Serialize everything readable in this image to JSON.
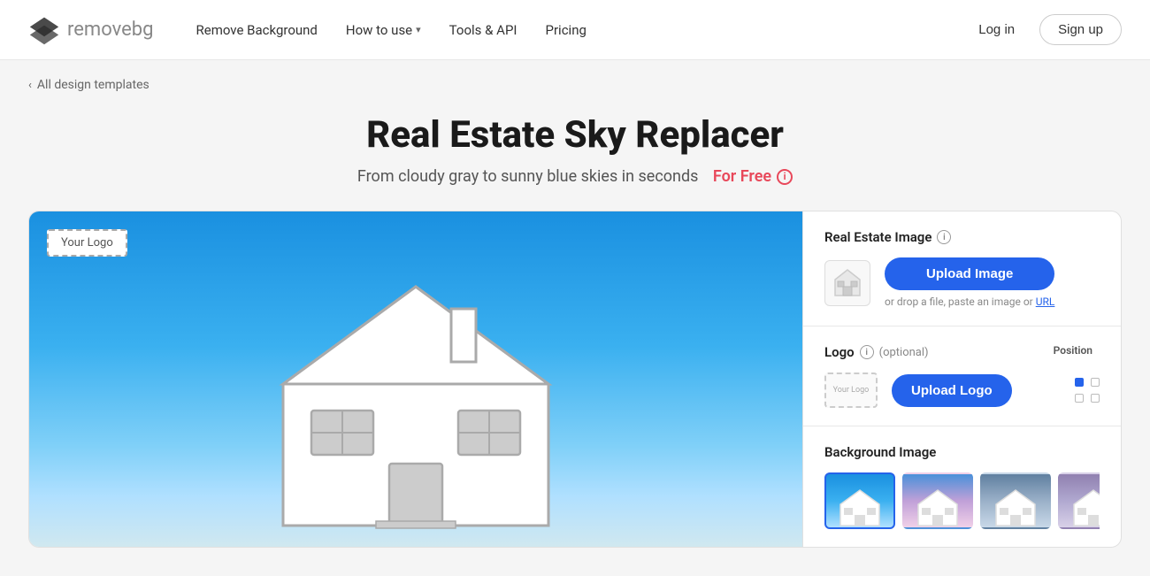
{
  "header": {
    "logo_text": "remove",
    "logo_text_suffix": "bg",
    "nav": [
      {
        "id": "remove-bg",
        "label": "Remove Background",
        "has_chevron": false
      },
      {
        "id": "how-to-use",
        "label": "How to use",
        "has_chevron": true
      },
      {
        "id": "tools-api",
        "label": "Tools & API",
        "has_chevron": false
      },
      {
        "id": "pricing",
        "label": "Pricing",
        "has_chevron": false
      }
    ],
    "login_label": "Log in",
    "signup_label": "Sign up"
  },
  "breadcrumb": {
    "label": "All design templates",
    "chevron": "‹"
  },
  "page": {
    "title": "Real Estate Sky Replacer",
    "subtitle": "From cloudy gray to sunny blue skies in seconds",
    "for_free": "For Free",
    "info_icon": "i"
  },
  "preview": {
    "logo_placeholder": "Your Logo"
  },
  "controls": {
    "real_estate_section": {
      "title": "Real Estate Image",
      "info_icon": "i",
      "upload_button": "Upload Image",
      "hint": "or drop a file, paste an image or",
      "hint_link": "URL"
    },
    "logo_section": {
      "title": "Logo",
      "info_icon": "i",
      "optional": "(optional)",
      "upload_button": "Upload Logo",
      "logo_placeholder": "Your Logo",
      "position_label": "Position"
    },
    "background_section": {
      "title": "Background Image",
      "thumbnails": [
        {
          "id": "sky-1",
          "alt": "Clear blue sky",
          "active": true
        },
        {
          "id": "sky-2",
          "alt": "Partly cloudy sky"
        },
        {
          "id": "sky-3",
          "alt": "Overcast sky"
        },
        {
          "id": "sky-4",
          "alt": "Purple sky"
        }
      ]
    }
  }
}
